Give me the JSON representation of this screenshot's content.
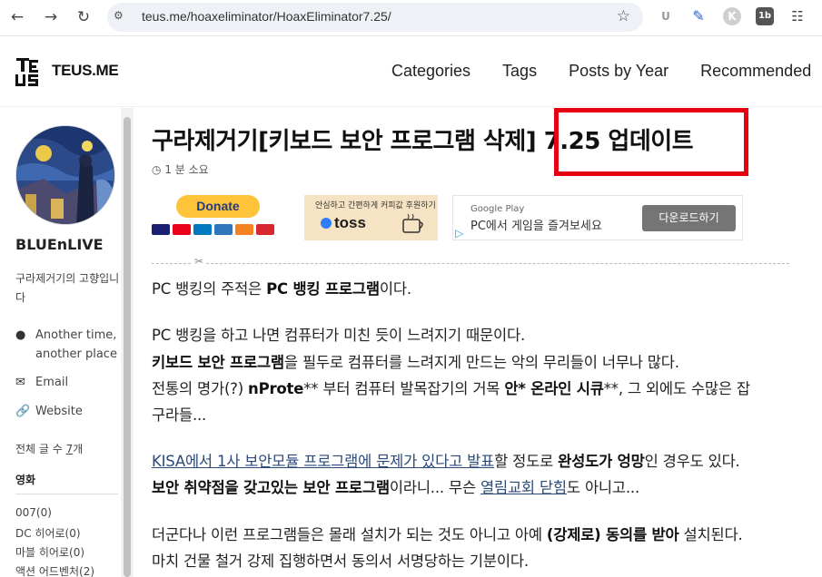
{
  "browser": {
    "url": "teus.me/hoaxeliminator/HoaxEliminator7.25/",
    "ext_labels": [
      "U",
      "K",
      "1b"
    ]
  },
  "site": {
    "logo_text": "TEUS.ME",
    "nav": [
      "Categories",
      "Tags",
      "Posts by Year",
      "Recommended"
    ]
  },
  "sidebar": {
    "author": "BLUEnLIVE",
    "bio": "구라제거기의 고향입니다",
    "links": [
      {
        "icon": "location-icon",
        "label1": "Another time,",
        "label2": "another place"
      },
      {
        "icon": "email-icon",
        "label1": "Email"
      },
      {
        "icon": "link-icon",
        "label1": "Website"
      }
    ],
    "post_count_prefix": "전체 글 수 ",
    "post_count": "7",
    "post_count_suffix": "개",
    "category_heading": "영화",
    "categories": [
      "007(0)",
      "DC 히어로(0)",
      "마블 히어로(0)",
      "액션 어드벤처(2)"
    ]
  },
  "post": {
    "title": "구라제거기[키보드 보안 프로그램 삭제] 7.25 업데이트",
    "read_time": "1 분 소요",
    "donate_label": "Donate",
    "toss_caption": "안심하고 간편하게 커피값 후원하기",
    "toss_logo": "toss",
    "ad_source": "Google Play",
    "ad_text": "PC에서 게임을 즐겨보세요",
    "ad_button": "다운로드하기",
    "p1_a": "PC 뱅킹의 주적은 ",
    "p1_b": "PC 뱅킹 프로그램",
    "p1_c": "이다.",
    "p2_line1": "PC 뱅킹을 하고 나면 컴퓨터가 미친 듯이 느려지기 때문이다.",
    "p2_line2_b": "키보드 보안 프로그램",
    "p2_line2_c": "을 필두로 컴퓨터를 느려지게 만드는 악의 무리들이 너무나 많다.",
    "p2_line3_a": "전통의 명가(?) ",
    "p2_line3_b": "nProte",
    "p2_line3_c": "** 부터 컴퓨터 발목잡기의 거목 ",
    "p2_line3_d": "안* 온라인 시큐",
    "p2_line3_e": "**, 그 외에도 수많은 잡",
    "p2_line4": "구라들...",
    "p3_link": "KISA에서 1사 보안모듈 프로그램에 문제가 있다고 발표",
    "p3_a": "할 정도로 ",
    "p3_b": "완성도가 엉망",
    "p3_c": "인 경우도 있다.",
    "p3_line2_b": "보안 취약점을 갖고있는 보안 프로그램",
    "p3_line2_c": "이라니... 무슨 ",
    "p3_line2_link": "열림교회 닫힘",
    "p3_line2_d": "도 아니고...",
    "p4_a": "더군다나 이런 프로그램들은 몰래 설치가 되는 것도 아니고 아예 ",
    "p4_b": "(강제로) 동의를 받아",
    "p4_c": " 설치된다.",
    "p4_line2": "마치 건물 철거 강제 집행하면서 동의서 서명당하는 기분이다."
  },
  "colors": {
    "highlight": "#e60012",
    "paypal_yellow": "#ffc439",
    "link": "#2b4a7a"
  }
}
